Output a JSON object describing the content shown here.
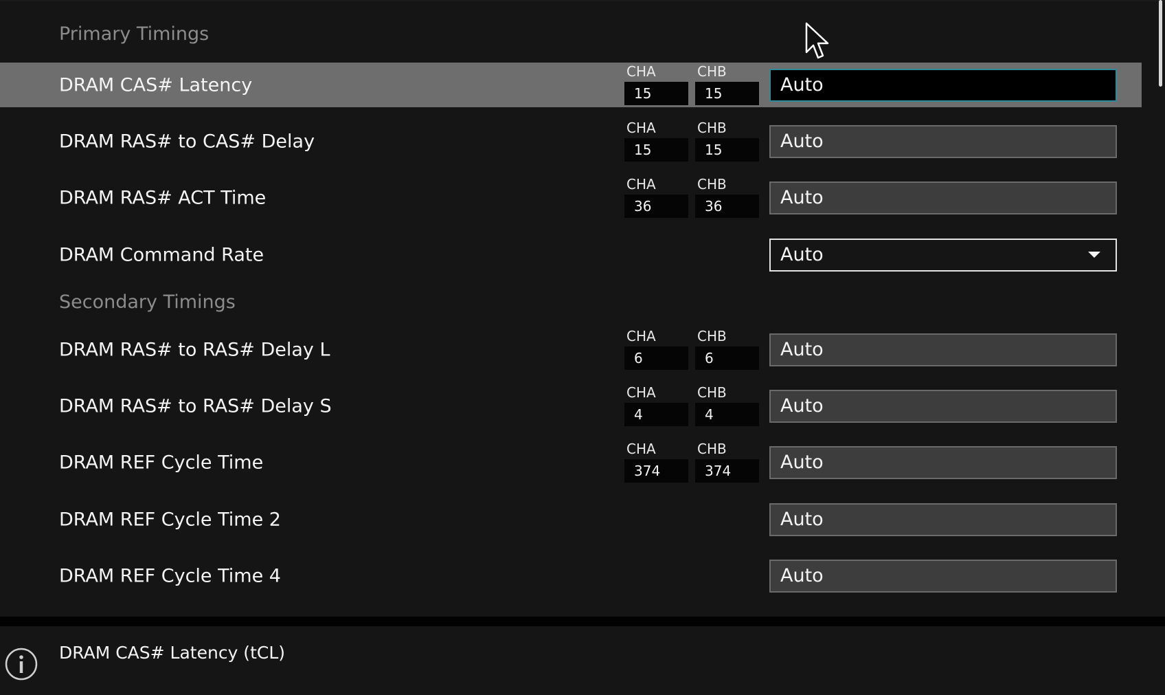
{
  "sections": {
    "primary": "Primary Timings",
    "secondary": "Secondary Timings"
  },
  "rows": [
    {
      "label": "DRAM CAS# Latency",
      "cha_label": "CHA",
      "cha_value": "15",
      "chb_label": "CHB",
      "chb_value": "15",
      "value": "Auto"
    },
    {
      "label": "DRAM RAS# to CAS# Delay",
      "cha_label": "CHA",
      "cha_value": "15",
      "chb_label": "CHB",
      "chb_value": "15",
      "value": "Auto"
    },
    {
      "label": "DRAM RAS# ACT Time",
      "cha_label": "CHA",
      "cha_value": "36",
      "chb_label": "CHB",
      "chb_value": "36",
      "value": "Auto"
    },
    {
      "label": "DRAM Command Rate",
      "value": "Auto"
    },
    {
      "label": "DRAM RAS# to RAS# Delay L",
      "cha_label": "CHA",
      "cha_value": "6",
      "chb_label": "CHB",
      "chb_value": "6",
      "value": "Auto"
    },
    {
      "label": "DRAM RAS# to RAS# Delay S",
      "cha_label": "CHA",
      "cha_value": "4",
      "chb_label": "CHB",
      "chb_value": "4",
      "value": "Auto"
    },
    {
      "label": "DRAM REF Cycle Time",
      "cha_label": "CHA",
      "cha_value": "374",
      "chb_label": "CHB",
      "chb_value": "374",
      "value": "Auto"
    },
    {
      "label": "DRAM REF Cycle Time 2",
      "value": "Auto"
    },
    {
      "label": "DRAM REF Cycle Time 4",
      "value": "Auto"
    }
  ],
  "help": {
    "text": "DRAM CAS# Latency (tCL)"
  },
  "icons": {
    "info": "info-icon",
    "dropdown": "chevron-down-icon",
    "cursor": "mouse-pointer-icon"
  },
  "colors": {
    "background": "#151515",
    "selected_row": "#6e6e6e",
    "active_border": "#2e8a96"
  }
}
